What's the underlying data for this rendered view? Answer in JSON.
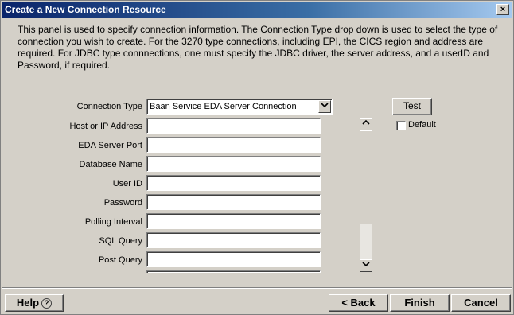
{
  "window": {
    "title": "Create a New Connection Resource",
    "close_symbol": "×"
  },
  "description": "This panel is used to specify connection information.  The Connection Type drop down is used to select the type of connection you wish to create. For the 3270 type connections, including EPI, the CICS region and address are required.  For JDBC type connnections, one must specify the JDBC driver, the server address, and a userID and Password, if required.",
  "connection_type": {
    "label": "Connection Type",
    "selected": "Baan Service EDA Server Connection",
    "dropdown_icon": "chevron-down-icon"
  },
  "fields": [
    {
      "label": "Host or IP Address",
      "value": ""
    },
    {
      "label": "EDA Server Port",
      "value": ""
    },
    {
      "label": "Database Name",
      "value": ""
    },
    {
      "label": "User ID",
      "value": ""
    },
    {
      "label": "Password",
      "value": ""
    },
    {
      "label": "Polling Interval",
      "value": ""
    },
    {
      "label": "SQL Query",
      "value": ""
    },
    {
      "label": "Post Query",
      "value": ""
    }
  ],
  "test_button": {
    "label": "Test"
  },
  "default_checkbox": {
    "label": "Default",
    "checked": false
  },
  "footer": {
    "help_label": "Help",
    "help_icon": "?",
    "back_label": "< Back",
    "finish_label": "Finish",
    "cancel_label": "Cancel"
  },
  "colors": {
    "title_bar_start": "#0a246a",
    "title_bar_end": "#a6caf0",
    "window_bg": "#d4d0c8"
  }
}
